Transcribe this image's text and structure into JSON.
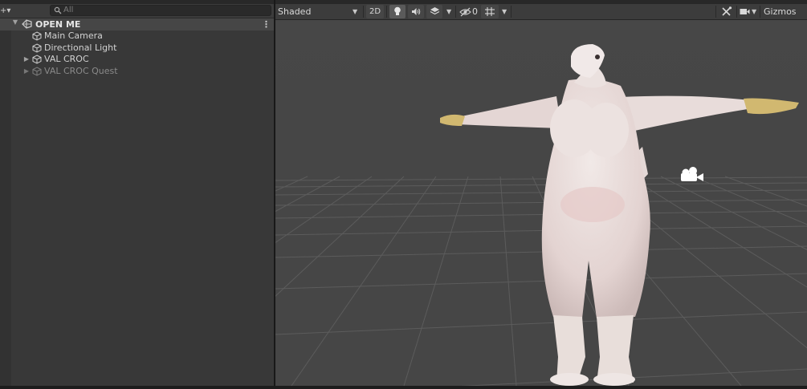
{
  "hierarchy": {
    "search": {
      "placeholder": "All"
    },
    "create_label": "+▾",
    "scene": {
      "name": "OPEN ME"
    },
    "items": [
      {
        "label": "Main Camera",
        "expandable": false,
        "dimmed": false
      },
      {
        "label": "Directional Light",
        "expandable": false,
        "dimmed": false
      },
      {
        "label": "VAL CROC",
        "expandable": true,
        "dimmed": false
      },
      {
        "label": "VAL CROC Quest",
        "expandable": true,
        "dimmed": true
      }
    ]
  },
  "scene_view": {
    "draw_mode": "Shaded",
    "mode_2d": "2D",
    "hidden_count": "0",
    "gizmos_label": "Gizmos"
  },
  "colors": {
    "panel": "#383838",
    "toolbar": "#3c3c3c",
    "selected_row": "#464646",
    "viewport": "#474747",
    "grid": "#5a5a5a"
  },
  "icons": [
    "search-icon",
    "unity-scene-icon",
    "gameobject-cube-icon",
    "kebab-menu-icon",
    "lighting-bulb-icon",
    "audio-speaker-icon",
    "effects-layers-icon",
    "hidden-eye-icon",
    "grid-snap-icon",
    "tools-icon",
    "camera-icon",
    "scene-camera-gizmo-icon"
  ]
}
